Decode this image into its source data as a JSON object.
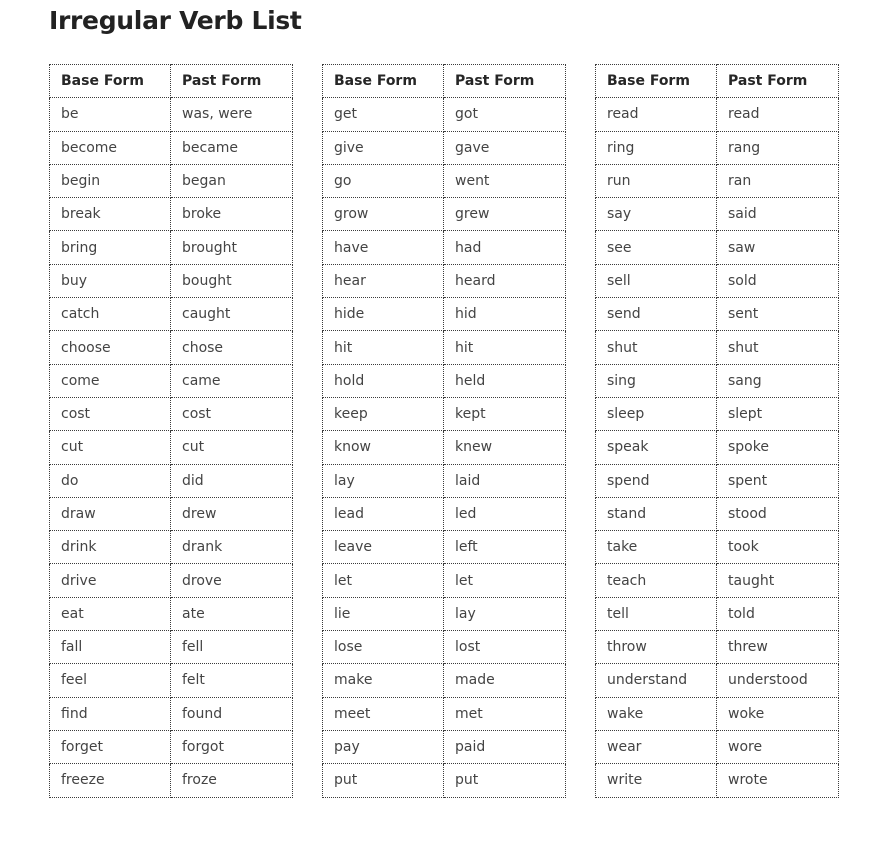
{
  "title": "Irregular Verb List",
  "tables": [
    {
      "headers": [
        "Base Form",
        "Past Form"
      ],
      "rows": [
        [
          "be",
          "was, were"
        ],
        [
          "become",
          "became"
        ],
        [
          "begin",
          "began"
        ],
        [
          "break",
          "broke"
        ],
        [
          "bring",
          "brought"
        ],
        [
          "buy",
          "bought"
        ],
        [
          "catch",
          "caught"
        ],
        [
          "choose",
          "chose"
        ],
        [
          "come",
          "came"
        ],
        [
          "cost",
          "cost"
        ],
        [
          "cut",
          "cut"
        ],
        [
          "do",
          "did"
        ],
        [
          "draw",
          "drew"
        ],
        [
          "drink",
          "drank"
        ],
        [
          "drive",
          "drove"
        ],
        [
          "eat",
          "ate"
        ],
        [
          "fall",
          "fell"
        ],
        [
          "feel",
          "felt"
        ],
        [
          "find",
          "found"
        ],
        [
          "forget",
          "forgot"
        ],
        [
          "freeze",
          "froze"
        ]
      ]
    },
    {
      "headers": [
        "Base Form",
        "Past Form"
      ],
      "rows": [
        [
          "get",
          "got"
        ],
        [
          "give",
          "gave"
        ],
        [
          "go",
          "went"
        ],
        [
          "grow",
          "grew"
        ],
        [
          "have",
          "had"
        ],
        [
          "hear",
          "heard"
        ],
        [
          "hide",
          "hid"
        ],
        [
          "hit",
          "hit"
        ],
        [
          "hold",
          "held"
        ],
        [
          "keep",
          "kept"
        ],
        [
          "know",
          "knew"
        ],
        [
          "lay",
          "laid"
        ],
        [
          "lead",
          "led"
        ],
        [
          "leave",
          "left"
        ],
        [
          "let",
          "let"
        ],
        [
          "lie",
          "lay"
        ],
        [
          "lose",
          "lost"
        ],
        [
          "make",
          "made"
        ],
        [
          "meet",
          "met"
        ],
        [
          "pay",
          "paid"
        ],
        [
          "put",
          "put"
        ]
      ]
    },
    {
      "headers": [
        "Base Form",
        "Past Form"
      ],
      "rows": [
        [
          "read",
          "read"
        ],
        [
          "ring",
          "rang"
        ],
        [
          "run",
          "ran"
        ],
        [
          "say",
          "said"
        ],
        [
          "see",
          "saw"
        ],
        [
          "sell",
          "sold"
        ],
        [
          "send",
          "sent"
        ],
        [
          "shut",
          "shut"
        ],
        [
          "sing",
          "sang"
        ],
        [
          "sleep",
          "slept"
        ],
        [
          "speak",
          "spoke"
        ],
        [
          "spend",
          "spent"
        ],
        [
          "stand",
          "stood"
        ],
        [
          "take",
          "took"
        ],
        [
          "teach",
          "taught"
        ],
        [
          "tell",
          "told"
        ],
        [
          "throw",
          "threw"
        ],
        [
          "understand",
          "understood"
        ],
        [
          "wake",
          "woke"
        ],
        [
          "wear",
          "wore"
        ],
        [
          "write",
          "wrote"
        ]
      ]
    }
  ]
}
